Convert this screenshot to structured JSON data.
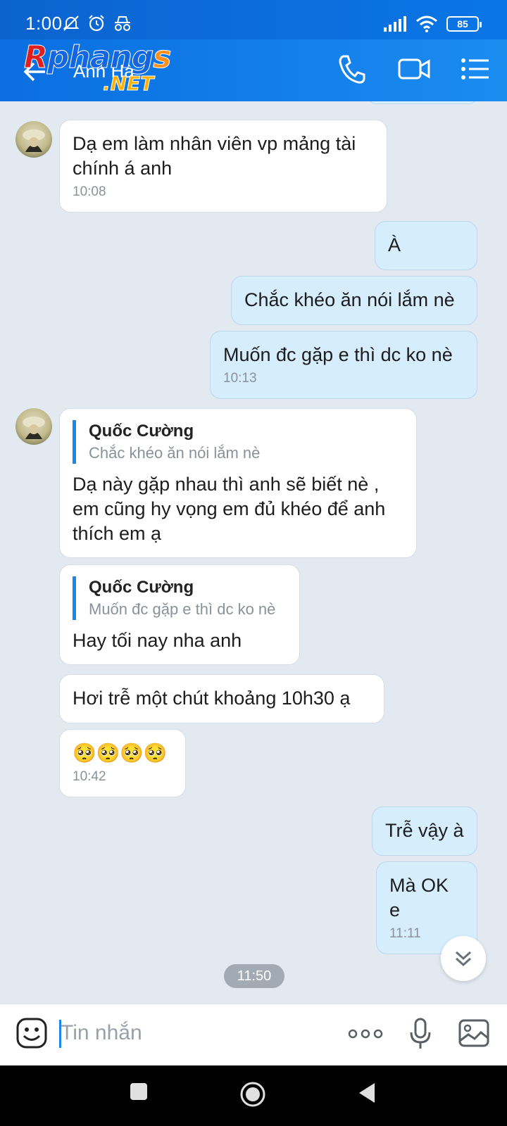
{
  "status_bar": {
    "time": "1:00",
    "battery": "85",
    "icons": [
      "mute-bell-icon",
      "alarm-icon",
      "incognito-icon",
      "signal-icon",
      "wifi-icon",
      "battery-icon"
    ]
  },
  "header": {
    "contact_name": "Anh Hà",
    "watermark": {
      "part1": "R",
      "part2": "phang",
      "part3": "s",
      "suffix": ".NET"
    },
    "icons": [
      "back-arrow-icon",
      "phone-icon",
      "video-icon",
      "menu-list-icon"
    ]
  },
  "messages": [
    {
      "side": "in",
      "text": "Dạ em làm nhân viên vp mảng tài chính á anh",
      "time": "10:08"
    },
    {
      "side": "out",
      "text": "À"
    },
    {
      "side": "out",
      "text": "Chắc khéo ăn nói lắm nè"
    },
    {
      "side": "out",
      "text": "Muốn đc gặp e thì dc ko nè",
      "time": "10:13"
    },
    {
      "side": "in",
      "quote_name": "Quốc Cường",
      "quote_text": "Chắc khéo ăn nói lắm nè",
      "text": "Dạ này gặp nhau thì anh sẽ biết nè , em cũng hy vọng em đủ khéo để anh thích em ạ"
    },
    {
      "side": "in",
      "quote_name": "Quốc Cường",
      "quote_text": "Muốn đc gặp e thì dc ko nè",
      "text": "Hay tối nay nha anh"
    },
    {
      "side": "in",
      "text": "Hơi trễ một chút khoảng 10h30 ạ"
    },
    {
      "side": "in",
      "text": "🥺🥺🥺🥺",
      "time": "10:42"
    },
    {
      "side": "out",
      "text": "Trễ vậy à"
    },
    {
      "side": "out",
      "text": "Mà OK e",
      "time": "11:11"
    }
  ],
  "time_divider": "11:50",
  "input": {
    "placeholder": "Tin nhắn"
  },
  "accent": "#1b86f0",
  "header_color": "#0a6ee0"
}
